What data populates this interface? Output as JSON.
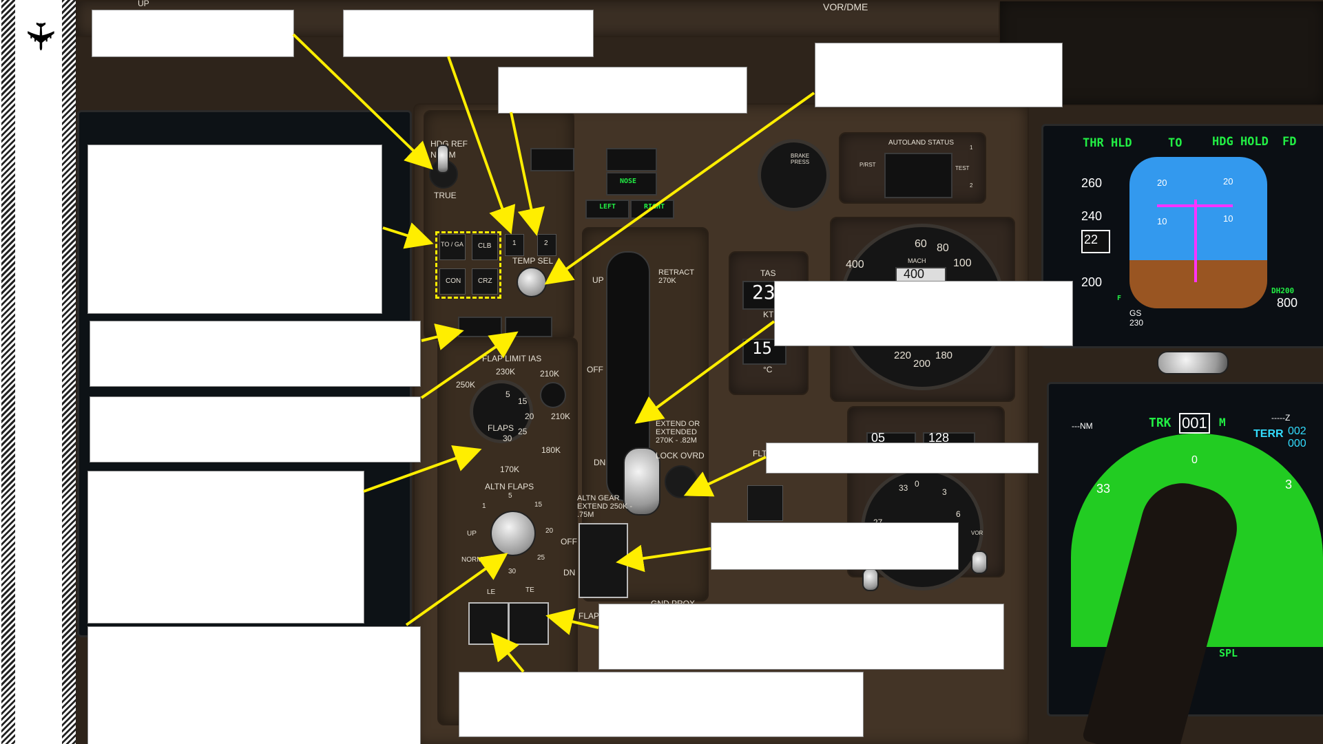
{
  "colors": {
    "callout_line": "#ffee00",
    "pfd_sky": "#3399ee",
    "pfd_ground": "#995522",
    "nd_terrain": "#22cc22",
    "annunciation_green": "#22ee44",
    "magenta": "#ff33ff",
    "panel": "#4a3a2a"
  },
  "icons": {
    "app": "airplane-icon"
  },
  "top_panel": {
    "label": "VOR/DME",
    "up_label": "UP"
  },
  "hdg_ref": {
    "title": "HDG REF",
    "norm": "NORM",
    "true": "TRUE"
  },
  "thrust_ref": {
    "to_ga": "TO / GA",
    "clb": "CLB",
    "con": "CON",
    "crz": "CRZ",
    "btn1": "1",
    "btn2": "2",
    "temp_sel": "TEMP SEL"
  },
  "gear_lights": {
    "nose": "NOSE",
    "left": "LEFT",
    "right": "RIGHT"
  },
  "gear_lever": {
    "up": "UP",
    "off": "OFF",
    "dn": "DN",
    "retract": "RETRACT 270K",
    "extend": "EXTEND OR EXTENDED 270K - .82M",
    "lock_ovrd": "LOCK OVRD"
  },
  "flap_gauge": {
    "title": "FLAP LIMIT IAS",
    "s230": "230K",
    "s210a": "210K",
    "s250": "250K",
    "s210b": "210K",
    "s180": "180K",
    "s170": "170K",
    "label": "FLAPS",
    "n5": "5",
    "n15": "15",
    "n20": "20",
    "n25": "25",
    "n30": "30"
  },
  "altn_flaps": {
    "title": "ALTN FLAPS",
    "up": "UP",
    "norm": "NORM",
    "n1": "1",
    "n5": "5",
    "n15": "15",
    "n20": "20",
    "n25": "25",
    "n30": "30",
    "le": "LE",
    "te": "TE"
  },
  "altn_gear": {
    "title": "ALTN GEAR EXTEND 250K - .75M",
    "off": "OFF",
    "dn": "DN"
  },
  "misc": {
    "gnd_prox": "GND PROX",
    "flap": "FLAP",
    "flt": "FLT"
  },
  "autoland": {
    "title": "AUTOLAND STATUS",
    "prst": "P/RST",
    "test": "TEST",
    "n1": "1",
    "n2": "2",
    "brake": "BRAKE PRESS"
  },
  "tas": {
    "title": "TAS",
    "value": "23",
    "kt": "KT",
    "temp": "15",
    "unit": "°C"
  },
  "asi": {
    "n60": "60",
    "n80": "80",
    "n100": "100",
    "n400": "400",
    "mach": "MACH",
    "window": "400",
    "n220": "220",
    "n200": "200",
    "n180": "180"
  },
  "rmi": {
    "vor": "VOR",
    "n33": "33",
    "n0": "0",
    "n3": "3",
    "n6": "6",
    "n27": "27",
    "win1": "05",
    "win2": "128"
  },
  "pfd": {
    "fma1": "THR HLD",
    "fma2": "TO",
    "fma3": "HDG HOLD",
    "fma4": "FD",
    "s260": "260",
    "s240": "240",
    "s220": "22",
    "s200": "200",
    "gs_label": "GS",
    "gs": "230",
    "dh_label": "DH200",
    "dh": "800",
    "p20": "20",
    "p10": "10",
    "f": "F"
  },
  "nd": {
    "nm": "---NM",
    "trk": "TRK",
    "hdg": "001",
    "m": "M",
    "z": "-----Z",
    "terr": "TERR",
    "terr1": "002",
    "terr2": "000",
    "n33": "33",
    "n3": "3",
    "n0": "0",
    "spl": "SPL"
  }
}
